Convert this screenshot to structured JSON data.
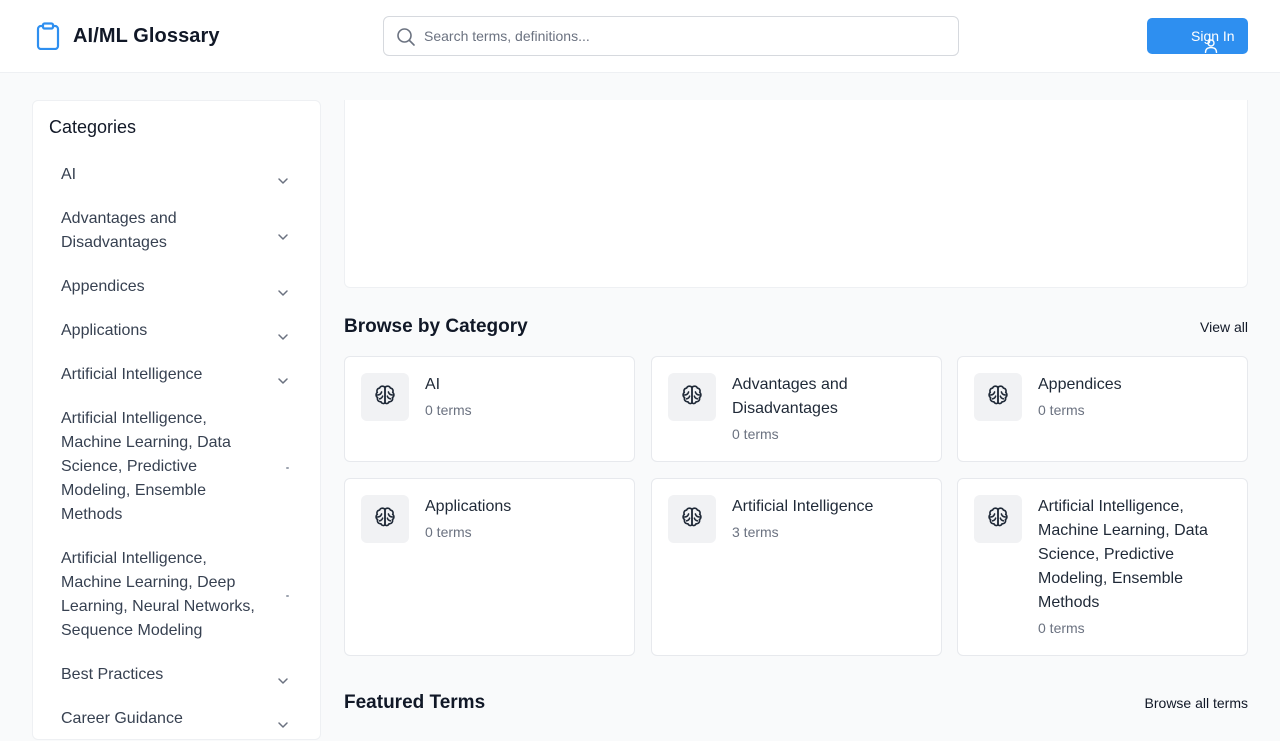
{
  "header": {
    "app_title": "AI/ML Glossary",
    "search_placeholder": "Search terms, definitions...",
    "sign_in_label": "Sign In",
    "accent_color": "#2e8ff0"
  },
  "sidebar": {
    "title": "Categories",
    "items": [
      {
        "label": "AI",
        "indicator": "chevron-down-icon"
      },
      {
        "label": "Advantages and Disadvantages",
        "indicator": "chevron-down-icon"
      },
      {
        "label": "Appendices",
        "indicator": "chevron-down-icon"
      },
      {
        "label": "Applications",
        "indicator": "chevron-down-icon"
      },
      {
        "label": "Artificial Intelligence",
        "indicator": "chevron-down-icon"
      },
      {
        "label": "Artificial Intelligence, Machine Learning, Data Science, Predictive Modeling, Ensemble Methods",
        "indicator": "dot"
      },
      {
        "label": "Artificial Intelligence, Machine Learning, Deep Learning, Neural Networks, Sequence Modeling",
        "indicator": "dot"
      },
      {
        "label": "Best Practices",
        "indicator": "chevron-down-icon"
      },
      {
        "label": "Career Guidance",
        "indicator": "chevron-down-icon"
      }
    ]
  },
  "browse": {
    "title": "Browse by Category",
    "view_all_label": "View all",
    "cards": [
      {
        "name": "AI",
        "count": "0 terms",
        "icon": "brain-icon"
      },
      {
        "name": "Advantages and Disadvantages",
        "count": "0 terms",
        "icon": "brain-icon"
      },
      {
        "name": "Appendices",
        "count": "0 terms",
        "icon": "brain-icon"
      },
      {
        "name": "Applications",
        "count": "0 terms",
        "icon": "brain-icon"
      },
      {
        "name": "Artificial Intelligence",
        "count": "3 terms",
        "icon": "brain-icon"
      },
      {
        "name": "Artificial Intelligence, Machine Learning, Data Science, Predictive Modeling, Ensemble Methods",
        "count": "0 terms",
        "icon": "brain-icon"
      }
    ]
  },
  "featured": {
    "title": "Featured Terms",
    "browse_all_label": "Browse all terms"
  }
}
